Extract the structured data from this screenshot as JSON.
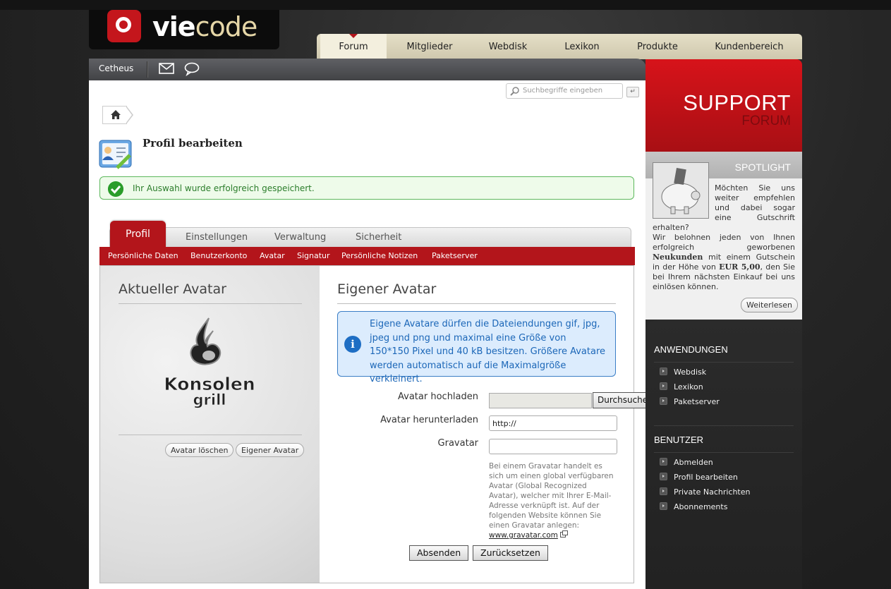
{
  "logo": {
    "part1": "vie",
    "part2": "code"
  },
  "main_nav": {
    "tabs": [
      {
        "label": "Forum",
        "active": true
      },
      {
        "label": "Mitglieder"
      },
      {
        "label": "Webdisk"
      },
      {
        "label": "Lexikon"
      },
      {
        "label": "Produkte"
      },
      {
        "label": "Kundenbereich"
      }
    ]
  },
  "userbar": {
    "username": "Cetheus"
  },
  "search": {
    "placeholder": "Suchbegriffe eingeben",
    "go": "↵"
  },
  "page": {
    "title": "Profil bearbeiten"
  },
  "success_message": "Ihr Auswahl wurde erfolgreich gespeichert.",
  "profile_tabs": {
    "active": "Profil",
    "others": [
      "Einstellungen",
      "Verwaltung",
      "Sicherheit"
    ]
  },
  "subnav": [
    "Persönliche Daten",
    "Benutzerkonto",
    "Avatar",
    "Signatur",
    "Persönliche Notizen",
    "Paketserver"
  ],
  "current_avatar": {
    "title": "Aktueller Avatar",
    "image_text_top": "Konsolen",
    "image_text_bottom": "grill",
    "delete_button": "Avatar löschen",
    "own_button": "Eigener Avatar"
  },
  "own_avatar": {
    "title": "Eigener Avatar",
    "info": "Eigene Avatare dürfen die Dateiendungen gif, jpg, jpeg und png und maximal eine Größe von 150*150 Pixel und 40 kB besitzen. Größere Avatare werden automatisch auf die Maximalgröße verkleinert.",
    "upload_label": "Avatar hochladen",
    "browse_button": "Durchsuchen...",
    "download_label": "Avatar herunterladen",
    "download_value": "http://",
    "gravatar_label": "Gravatar",
    "gravatar_value": "",
    "gravatar_hint": "Bei einem Gravatar handelt es sich um einen global verfügbaren Avatar (Global Recognized Avatar), welcher mit Ihrer E-Mail-Adresse verknüpft ist. Auf der folgenden Website können Sie einen Gravatar anlegen:",
    "gravatar_link": "www.gravatar.com",
    "submit_button": "Absenden",
    "reset_button": "Zurücksetzen"
  },
  "sidebar": {
    "support_title": "SUPPORT",
    "support_subtitle": "FORUM",
    "spotlight": {
      "title": "SPOTLIGHT",
      "text_1": "Möchten Sie uns weiter empfehlen und dabei sogar eine Gutschrift erhalten?",
      "text_2": "Wir belohnen jeden von Ihnen erfolgreich geworbenen",
      "highlight_1": "Neukunden",
      "text_3": "mit einem Gutschein in der Höhe von",
      "highlight_2": "EUR 5,00",
      "text_4": ", den Sie bei Ihrem nächsten Einkauf bei uns einlösen können.",
      "more_button": "Weiterlesen"
    },
    "anwendungen": {
      "title": "ANWENDUNGEN",
      "items": [
        "Webdisk",
        "Lexikon",
        "Paketserver"
      ]
    },
    "benutzer": {
      "title": "BENUTZER",
      "items": [
        "Abmelden",
        "Profil bearbeiten",
        "Private Nachrichten",
        "Abonnements"
      ]
    }
  },
  "colors": {
    "brand_red": "#b3151b",
    "success_green": "#2a9d2a",
    "info_blue": "#1c67b8"
  }
}
